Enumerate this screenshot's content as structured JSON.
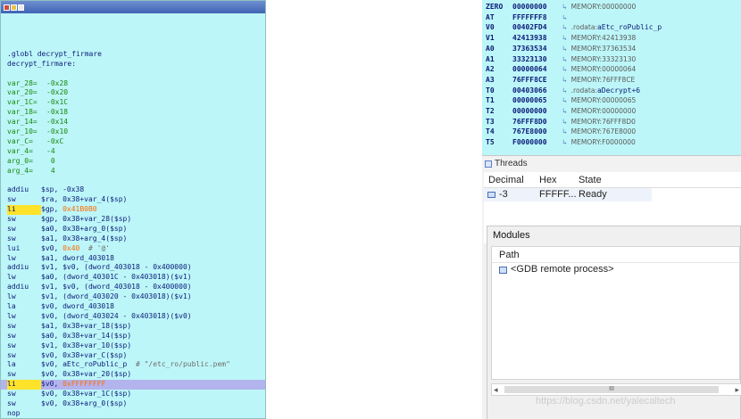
{
  "disassembly": {
    "lines": [
      {
        "kind": "blank"
      },
      {
        "kind": "text",
        "text": ".globl decrypt_firmare"
      },
      {
        "kind": "text",
        "text": "decrypt_firmare:"
      },
      {
        "kind": "blank"
      },
      {
        "kind": "var",
        "name": "var_28=",
        "value": "-0x28"
      },
      {
        "kind": "var",
        "name": "var_20=",
        "value": "-0x20"
      },
      {
        "kind": "var",
        "name": "var_1C=",
        "value": "-0x1C"
      },
      {
        "kind": "var",
        "name": "var_18=",
        "value": "-0x18"
      },
      {
        "kind": "var",
        "name": "var_14=",
        "value": "-0x14"
      },
      {
        "kind": "var",
        "name": "var_10=",
        "value": "-0x10"
      },
      {
        "kind": "var",
        "name": "var_C=",
        "value": "-0xC"
      },
      {
        "kind": "var",
        "name": "var_4=",
        "value": "-4"
      },
      {
        "kind": "var",
        "name": "arg_0=",
        "value": " 0"
      },
      {
        "kind": "var",
        "name": "arg_4=",
        "value": " 4"
      },
      {
        "kind": "blank"
      },
      {
        "kind": "ins",
        "mn": "addiu",
        "ops": "$sp, -0x38"
      },
      {
        "kind": "ins",
        "mn": "sw",
        "ops": "$ra, 0x38+var_4($sp)"
      },
      {
        "kind": "ins",
        "mn": "li",
        "mark": "yellow",
        "ops": "$gp, ",
        "hex": "0x41B0B0"
      },
      {
        "kind": "ins",
        "mn": "sw",
        "ops": "$gp, 0x38+var_28($sp)"
      },
      {
        "kind": "ins",
        "mn": "sw",
        "ops": "$a0, 0x38+arg_0($sp)"
      },
      {
        "kind": "ins",
        "mn": "sw",
        "ops": "$a1, 0x38+arg_4($sp)"
      },
      {
        "kind": "ins",
        "mn": "lui",
        "ops": "$v0, ",
        "hex": "0x40",
        "cmt": "  # '@'"
      },
      {
        "kind": "ins",
        "mn": "lw",
        "ops": "$a1, dword_403018"
      },
      {
        "kind": "ins",
        "mn": "addiu",
        "ops": "$v1, $v0, (dword_403018 - 0x400000)"
      },
      {
        "kind": "ins",
        "mn": "lw",
        "ops": "$a0, (dword_40301C - 0x403018)($v1)"
      },
      {
        "kind": "ins",
        "mn": "addiu",
        "ops": "$v1, $v0, (dword_403018 - 0x400000)"
      },
      {
        "kind": "ins",
        "mn": "lw",
        "ops": "$v1, (dword_403020 - 0x403018)($v1)"
      },
      {
        "kind": "ins",
        "mn": "la",
        "ops": "$v0, dword_403018"
      },
      {
        "kind": "ins",
        "mn": "lw",
        "ops": "$v0, (dword_403024 - 0x403018)($v0)"
      },
      {
        "kind": "ins",
        "mn": "sw",
        "ops": "$a1, 0x38+var_18($sp)"
      },
      {
        "kind": "ins",
        "mn": "sw",
        "ops": "$a0, 0x38+var_14($sp)"
      },
      {
        "kind": "ins",
        "mn": "sw",
        "ops": "$v1, 0x38+var_10($sp)"
      },
      {
        "kind": "ins",
        "mn": "sw",
        "ops": "$v0, 0x38+var_C($sp)"
      },
      {
        "kind": "ins",
        "mn": "la",
        "ops": "$v0, aEtc_roPublic_p",
        "cmt": "  # \"/etc_ro/public.pem\""
      },
      {
        "kind": "ins",
        "mn": "sw",
        "ops": "$v0, 0x38+var_20($sp)"
      },
      {
        "kind": "ins",
        "mn": "li",
        "mark": "yellow",
        "ops": "$v0, ",
        "hex": "0xFFFFFFFF",
        "highlight": true
      },
      {
        "kind": "ins",
        "mn": "sw",
        "ops": "$v0, 0x38+var_1C($sp)"
      },
      {
        "kind": "ins",
        "mn": "sw",
        "ops": "$v0, 0x38+arg_0($sp)"
      },
      {
        "kind": "ins",
        "mn": "nop",
        "ops": ""
      }
    ]
  },
  "registers": [
    {
      "name": "ZERO",
      "value": "00000000",
      "desc": "MEMORY:00000000"
    },
    {
      "name": "AT",
      "value": "FFFFFFF8",
      "desc": ""
    },
    {
      "name": "V0",
      "value": "00402FD4",
      "desc": ".rodata:",
      "ref": "aEtc_roPublic_p"
    },
    {
      "name": "V1",
      "value": "42413938",
      "desc": "MEMORY:42413938"
    },
    {
      "name": "A0",
      "value": "37363534",
      "desc": "MEMORY:37363534"
    },
    {
      "name": "A1",
      "value": "33323130",
      "desc": "MEMORY:33323130"
    },
    {
      "name": "A2",
      "value": "00000064",
      "desc": "MEMORY:00000064"
    },
    {
      "name": "A3",
      "value": "76FFF8CE",
      "desc": "MEMORY:76FFF8CE"
    },
    {
      "name": "T0",
      "value": "00403066",
      "desc": ".rodata:",
      "ref": "aDecrypt+6"
    },
    {
      "name": "T1",
      "value": "00000065",
      "desc": "MEMORY:00000065"
    },
    {
      "name": "T2",
      "value": "00000000",
      "desc": "MEMORY:00000000"
    },
    {
      "name": "T3",
      "value": "76FFF8D0",
      "desc": "MEMORY:76FFF8D0"
    },
    {
      "name": "T4",
      "value": "767E8000",
      "desc": "MEMORY:767E8000"
    },
    {
      "name": "T5",
      "value": "F0000000",
      "desc": "MEMORY:F0000000"
    }
  ],
  "threads": {
    "title": "Threads",
    "columns": [
      "Decimal",
      "Hex",
      "State"
    ],
    "rows": [
      {
        "decimal": "-3",
        "hex": "FFFFF...",
        "state": "Ready"
      }
    ]
  },
  "modules": {
    "title": "Modules",
    "column": "Path",
    "rows": [
      "<GDB remote process>"
    ],
    "scroll_thumb": "III"
  },
  "watermark": "https://blog.csdn.net/yalecaltech"
}
